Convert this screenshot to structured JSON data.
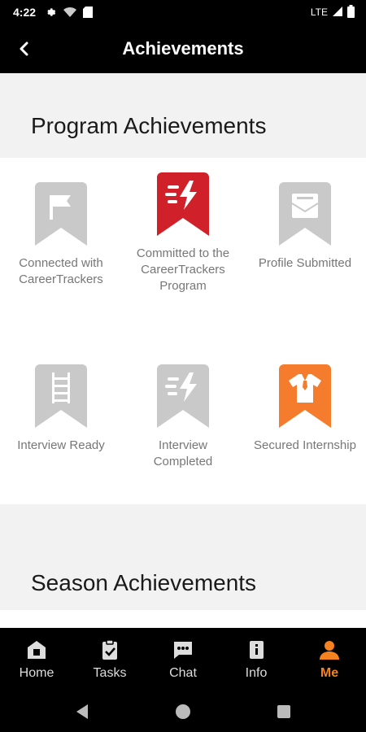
{
  "status_bar": {
    "time": "4:22",
    "network": "LTE"
  },
  "app_bar": {
    "title": "Achievements"
  },
  "program_section": {
    "heading": "Program Achievements",
    "badges": [
      {
        "label": "Connected with CareerTrackers",
        "color": "#c9c9c9",
        "icon": "flag-icon",
        "earned": false
      },
      {
        "label": "Committed to the CareerTrackers Program",
        "color": "#d0202a",
        "icon": "lightning-icon",
        "earned": true
      },
      {
        "label": "Profile Submitted",
        "color": "#c9c9c9",
        "icon": "envelope-icon",
        "earned": false
      },
      {
        "label": "Interview Ready",
        "color": "#c9c9c9",
        "icon": "ladder-icon",
        "earned": false
      },
      {
        "label": "Interview Completed",
        "color": "#c9c9c9",
        "icon": "lightning-icon",
        "earned": false
      },
      {
        "label": "Secured Internship",
        "color": "#f57c2c",
        "icon": "shirt-icon",
        "earned": true
      }
    ]
  },
  "season_section": {
    "heading": "Season Achievements",
    "badges": [
      {
        "color": "#c9c9c9"
      },
      {
        "color": "#f7c531"
      }
    ]
  },
  "bottom_nav": {
    "items": [
      {
        "label": "Home",
        "icon": "home-icon"
      },
      {
        "label": "Tasks",
        "icon": "clipboard-icon"
      },
      {
        "label": "Chat",
        "icon": "chat-icon"
      },
      {
        "label": "Info",
        "icon": "info-book-icon"
      },
      {
        "label": "Me",
        "icon": "person-icon",
        "active": true
      }
    ],
    "active_color": "#f5821f"
  }
}
